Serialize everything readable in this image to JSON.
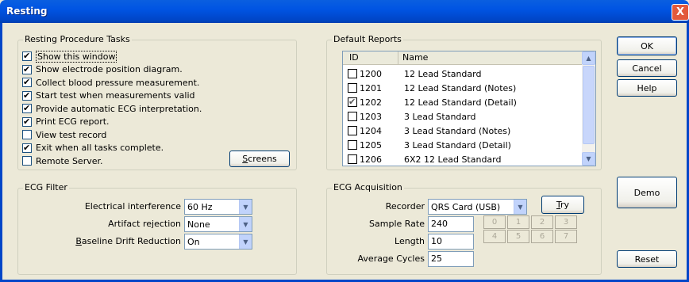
{
  "window": {
    "title": "Resting",
    "close": "X"
  },
  "tasks": {
    "legend": "Resting Procedure Tasks",
    "screens_button": "Screens",
    "items": [
      {
        "label": "Show this window",
        "checked": true
      },
      {
        "label": "Show electrode position diagram.",
        "checked": true
      },
      {
        "label": "Collect blood pressure measurement.",
        "checked": true
      },
      {
        "label": "Start test when measurements valid",
        "checked": true
      },
      {
        "label": "Provide automatic ECG interpretation.",
        "checked": true
      },
      {
        "label": "Print ECG report.",
        "checked": true
      },
      {
        "label": "View test record",
        "checked": false
      },
      {
        "label": "Exit when all tasks complete.",
        "checked": true
      },
      {
        "label": "Remote Server.",
        "checked": false
      }
    ]
  },
  "reports": {
    "legend": "Default Reports",
    "col_id": "ID",
    "col_name": "Name",
    "rows": [
      {
        "id": "1200",
        "name": "12 Lead Standard",
        "checked": false
      },
      {
        "id": "1201",
        "name": "12 Lead Standard (Notes)",
        "checked": false
      },
      {
        "id": "1202",
        "name": "12 Lead Standard (Detail)",
        "checked": true
      },
      {
        "id": "1203",
        "name": "3 Lead Standard",
        "checked": false
      },
      {
        "id": "1204",
        "name": "3 Lead Standard (Notes)",
        "checked": false
      },
      {
        "id": "1205",
        "name": "3 Lead Standard (Detail)",
        "checked": false
      },
      {
        "id": "1206",
        "name": "6X2 12 Lead Standard",
        "checked": false
      }
    ]
  },
  "buttons": {
    "ok": "OK",
    "cancel": "Cancel",
    "help": "Help",
    "demo": "Demo",
    "reset": "Reset",
    "try": "Try"
  },
  "filter": {
    "legend": "ECG Filter",
    "interference_label": "Electrical interference",
    "interference_value": "60 Hz",
    "artifact_label": "Artifact rejection",
    "artifact_value": "None",
    "drift_label": "Baseline Drift Reduction",
    "drift_value": "On"
  },
  "acquisition": {
    "legend": "ECG Acquisition",
    "recorder_label": "Recorder",
    "recorder_value": "QRS Card (USB)",
    "rate_label": "Sample Rate",
    "rate_value": "240",
    "length_label": "Length",
    "length_value": "10",
    "cycles_label": "Average Cycles",
    "cycles_value": "25",
    "numbers": [
      "0",
      "1",
      "2",
      "3",
      "4",
      "5",
      "6",
      "7"
    ]
  }
}
